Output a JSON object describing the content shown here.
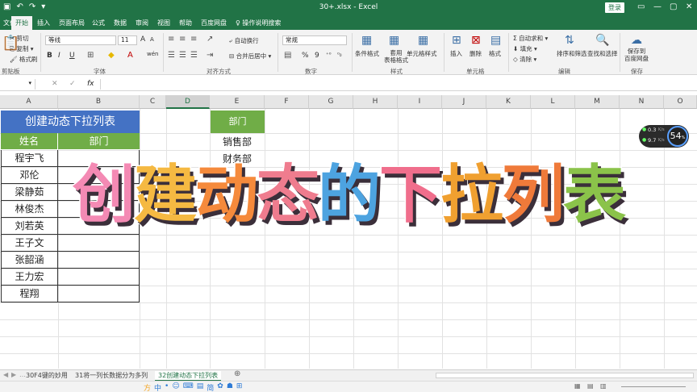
{
  "window": {
    "title": "30+.xlsx  -  Excel",
    "login": "登录",
    "controls": [
      "—",
      "▢",
      "✕"
    ]
  },
  "tabs": [
    "开始",
    "插入",
    "页面布局",
    "公式",
    "数据",
    "审阅",
    "视图",
    "帮助",
    "百度网盘"
  ],
  "tell_me": "操作说明搜索",
  "ribbon": {
    "clipboard": {
      "cut": "剪切",
      "copy": "复制 ▾",
      "painter": "格式刷",
      "group": "剪贴板"
    },
    "font": {
      "name": "等线",
      "size": "11",
      "grow": "A",
      "shrink": "A",
      "bold": "B",
      "italic": "I",
      "underline": "U",
      "group": "字体",
      "phonetic": "wén"
    },
    "alignment": {
      "wrap": "自动换行",
      "merge": "合并后居中",
      "group": "对齐方式"
    },
    "number": {
      "format": "常规",
      "percent": "%",
      "comma": "9",
      "group": "数字"
    },
    "styles": {
      "conditional": "条件格式",
      "table": "套用\n表格格式",
      "cell_styles": "单元格样式",
      "group": "样式"
    },
    "cells": {
      "insert": "插入",
      "delete": "删除",
      "format": "格式",
      "group": "单元格"
    },
    "editing": {
      "autosum": "自动求和 ▾",
      "fill": "填充 ▾",
      "clear": "清除 ▾",
      "sort": "排序和筛选",
      "find": "查找和选择",
      "group": "编辑"
    },
    "save": {
      "label": "保存到\n百度网盘",
      "group": "保存"
    }
  },
  "formula_bar": {
    "fx": "fx",
    "cancel": "✕",
    "enter": "✓"
  },
  "columns": [
    "A",
    "B",
    "C",
    "D",
    "E",
    "F",
    "G",
    "H",
    "I",
    "J",
    "K",
    "L",
    "M",
    "N",
    "O"
  ],
  "sheet": {
    "title": "创建动态下拉列表",
    "headers": {
      "name": "姓名",
      "dept": "部门"
    },
    "names": [
      "程宇飞",
      "邓伦",
      "梁静茹",
      "林俊杰",
      "刘若英",
      "王子文",
      "张韶涵",
      "王力宏",
      "程翔"
    ],
    "dept_header": "部门",
    "depts": [
      "销售部",
      "财务部"
    ]
  },
  "overlay_title": [
    "创",
    "建",
    "动",
    "态",
    "的",
    "下",
    "拉",
    "列",
    "表"
  ],
  "overlay_colors": [
    "#f48ab4",
    "#f5b942",
    "#f58a3c",
    "#ef7c8e",
    "#4da3e0",
    "#f06e8c",
    "#f0a030",
    "#ef7a3a",
    "#8bc34a"
  ],
  "net_widget": {
    "up": "0.3",
    "down": "9.7",
    "unit": "K/s",
    "percent": "54",
    "percent_unit": "%"
  },
  "sheet_tabs": [
    "30F4键的妙用",
    "31将一列长数据分为多列",
    "32创建动态下拉列表"
  ],
  "ime_icons": [
    "方",
    "中",
    "•",
    "☺",
    "⌨",
    "▤",
    "简",
    "✿",
    "☗",
    "⊞"
  ]
}
